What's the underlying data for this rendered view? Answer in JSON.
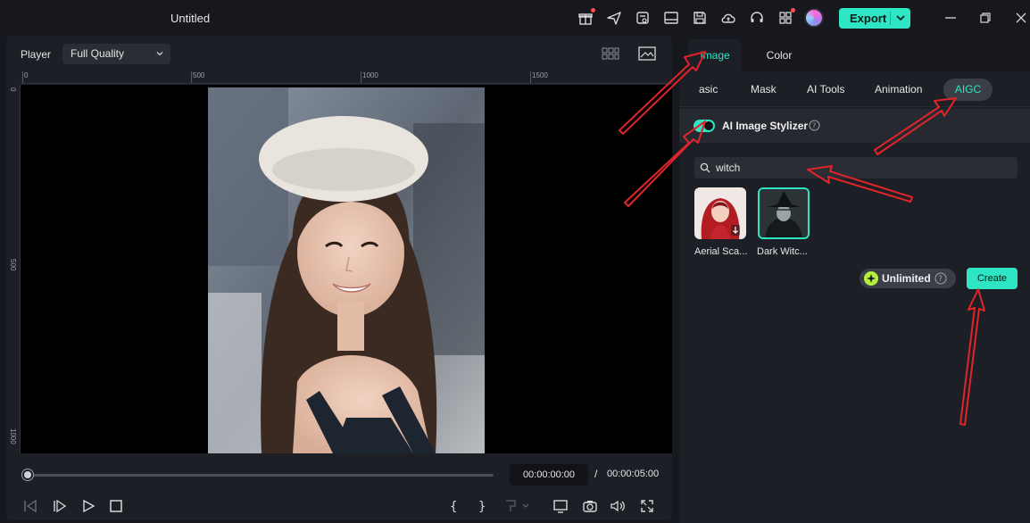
{
  "window": {
    "title": "Untitled"
  },
  "titlebar": {
    "icons": [
      "gift-icon",
      "send-icon",
      "media-settings-icon",
      "layout-icon",
      "save-icon",
      "cloud-icon",
      "headset-icon",
      "apps-icon"
    ],
    "export_label": "Export"
  },
  "player": {
    "label": "Player",
    "quality": "Full Quality",
    "ruler_top": [
      "0",
      "500",
      "1000",
      "1500"
    ],
    "ruler_left": [
      "0",
      "500",
      "1000"
    ],
    "time_current": "00:00:00:00",
    "time_sep": "/",
    "time_total": "00:00:05:00",
    "progress": 0
  },
  "panel": {
    "tabs": [
      "Image",
      "Color"
    ],
    "active_tab": "Image",
    "sub_tabs": [
      "asic",
      "Mask",
      "AI Tools",
      "Animation",
      "AIGC"
    ],
    "active_sub_tab": "AIGC",
    "stylizer": {
      "label": "AI Image Stylizer",
      "enabled": true
    },
    "search": {
      "value": "witch"
    },
    "styles": [
      {
        "label": "Aerial Sca..."
      },
      {
        "label": "Dark Witc...",
        "selected": true
      }
    ],
    "unlimited_label": "Unlimited",
    "create_label": "Create"
  },
  "colors": {
    "accent": "#2ee6c3",
    "annotation": "#e0242a",
    "background": "#16181d",
    "panel": "#1c1f25"
  }
}
